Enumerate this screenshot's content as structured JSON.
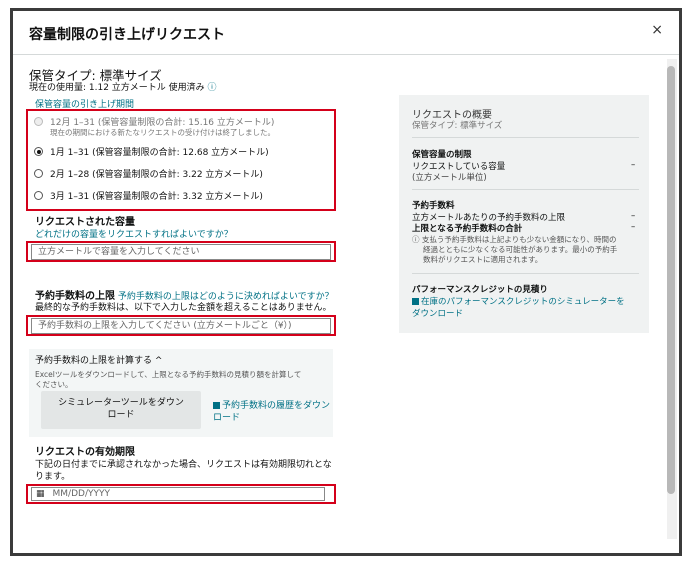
{
  "modal": {
    "title": "容量制限の引き上げリクエスト",
    "close_glyph": "×"
  },
  "storage": {
    "type_label": "保管タイプ: 標準サイズ",
    "current_usage": "現在の使用量: 1.12 立方メートル 使用済み",
    "info_glyph": "ⓘ",
    "period_link": "保管容量の引き上げ期間"
  },
  "periods": [
    {
      "label": "12月 1–31 (保管容量制限の合計: 15.16 立方メートル)",
      "note": "現在の期間における新たなリクエストの受け付けは終了しました。",
      "state": "disabled"
    },
    {
      "label": "1月 1–31 (保管容量制限の合計: 12.68 立方メートル)",
      "state": "selected"
    },
    {
      "label": "2月 1–28 (保管容量制限の合計: 3.22 立方メートル)",
      "state": "unselected"
    },
    {
      "label": "3月 1–31 (保管容量制限の合計: 3.32 立方メートル)",
      "state": "unselected"
    }
  ],
  "requested": {
    "heading": "リクエストされた容量",
    "help_link": "どれだけの容量をリクエストすればよいですか？",
    "placeholder": "立方メートルで容量を入力してください"
  },
  "fee_cap": {
    "heading": "予約手数料の上限",
    "help_link": "予約手数料の上限はどのように決めればよいですか？",
    "description": "最終的な予約手数料は、以下で入力した金額を超えることはありません。",
    "placeholder": "予約手数料の上限を入力してください (立方メートルごと（¥）)"
  },
  "calculator": {
    "toggle_label": "予約手数料の上限を計算する",
    "toggle_glyph": "^",
    "description_line1": "Excelツールをダウンロードして、上限となる予約手数料の見積り額を計算して",
    "description_line2": "ください。",
    "sim_button_line1": "シミュレーターツールをダウン",
    "sim_button_line2": "ロード",
    "history_link_line1": "予約手数料の履歴をダウン",
    "history_link_line2": "ロード"
  },
  "expiry": {
    "heading": "リクエストの有効期限",
    "description_line1": "下記の日付までに承認されなかった場合、リクエストは有効期限切れとな",
    "description_line2": "ります。",
    "placeholder": "MM/DD/YYYY",
    "calendar_glyph": "▦"
  },
  "summary": {
    "title": "リクエストの概要",
    "type": "保管タイプ: 標準サイズ",
    "limit_heading": "保管容量の制限",
    "requested_label": "リクエストしている容量",
    "unit_note": "(立方メートル単位)",
    "requested_value": "–",
    "fee_heading": "予約手数料",
    "fee_per_unit": "立方メートルあたりの予約手数料の上限",
    "fee_per_unit_value": "–",
    "fee_total": "上限となる予約手数料の合計",
    "fee_total_value": "–",
    "note_line1": "支払う予約手数料は上記よりも少ない金額になり、時間の",
    "note_line2": "経過とともに少なくなる可能性があります。最小の予約手",
    "note_line3": "数料がリクエストに適用されます。",
    "credit_heading": "パフォーマンスクレジットの見積り",
    "credit_link_line1": "在庫のパフォーマンスクレジットのシミュレーターを",
    "credit_link_line2": "ダウンロード"
  }
}
